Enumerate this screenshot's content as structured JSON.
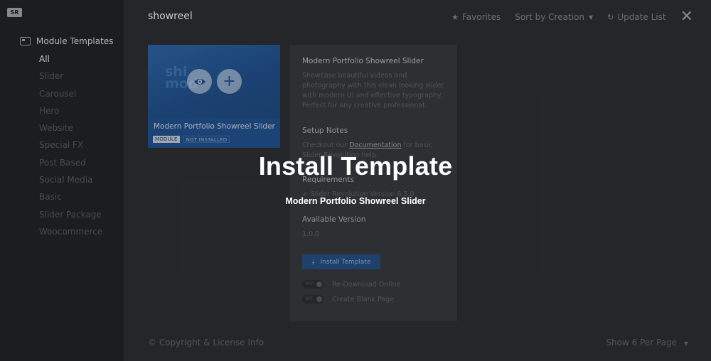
{
  "sidebar": {
    "logo": "SR",
    "heading": "Module Templates",
    "items": [
      {
        "label": "All"
      },
      {
        "label": "Slider"
      },
      {
        "label": "Carousel"
      },
      {
        "label": "Hero"
      },
      {
        "label": "Website"
      },
      {
        "label": "Special FX"
      },
      {
        "label": "Post Based"
      },
      {
        "label": "Social Media"
      },
      {
        "label": "Basic"
      },
      {
        "label": "Slider Package"
      },
      {
        "label": "Woocommerce"
      }
    ]
  },
  "header": {
    "title": "showreel",
    "favorites": "Favorites",
    "sort": "Sort by Creation",
    "update": "Update List"
  },
  "card": {
    "title": "Modern Portfolio Showreel Slider",
    "tag_module": "MODULE",
    "tag_status": "NOT INSTALLED",
    "ghost_line1": "shi",
    "ghost_line2": "mod"
  },
  "panel": {
    "title": "Modern Portfolio Showreel Slider",
    "description": "Showcase beautiful videos and photography with this clean looking slider with modern UI and effective typography. Perfect for any creative professional.",
    "setup_heading": "Setup Notes",
    "setup_pre": "Checkout our ",
    "setup_link": "Documentation",
    "setup_post": " for basic Slider Revolution help.",
    "req_heading": "Requirements",
    "req_item": "Slider Revolution Version 6.5.0",
    "version_heading": "Available Version",
    "version_value": "1.0.0",
    "install_label": "Install Template",
    "toggle_off": "OFF",
    "redownload_label": "Re-Download Online",
    "blank_page_label": "Create Blank Page"
  },
  "footer": {
    "copyright": "© Copyright & License Info",
    "per_page": "Show 6 Per Page"
  },
  "overlay": {
    "title": "Install Template",
    "subtitle": "Modern Portfolio Showreel Slider"
  }
}
